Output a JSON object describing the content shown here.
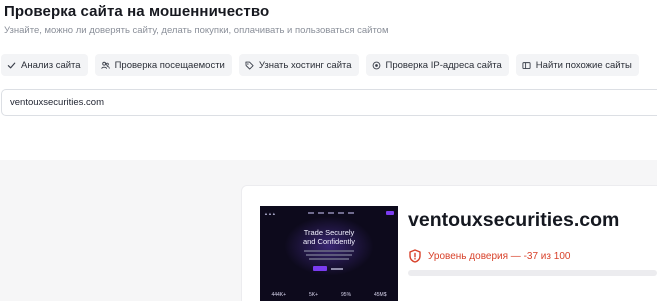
{
  "header": {
    "title": "Проверка сайта на мошенничество",
    "subtitle": "Узнайте, можно ли доверять сайту, делать покупки, оплачивать и пользоваться сайтом"
  },
  "tabs": [
    {
      "label": "Анализ сайта",
      "icon": "check-icon"
    },
    {
      "label": "Проверка посещаемости",
      "icon": "users-icon"
    },
    {
      "label": "Узнать хостинг сайта",
      "icon": "tag-icon"
    },
    {
      "label": "Проверка IP-адреса сайта",
      "icon": "target-icon"
    },
    {
      "label": "Найти похожие сайты",
      "icon": "window-icon"
    }
  ],
  "search": {
    "value": "ventouxsecurities.com"
  },
  "result": {
    "site_name": "ventouxsecurities.com",
    "trust_label": "Уровень доверия — -37 из 100",
    "trust_score": 0,
    "trust_color": "#d8412a",
    "preview": {
      "headline_line1": "Trade Securely",
      "headline_line2": "and Confidently",
      "stats": [
        "444K+",
        "5K+",
        "95%",
        "45M$"
      ]
    }
  }
}
